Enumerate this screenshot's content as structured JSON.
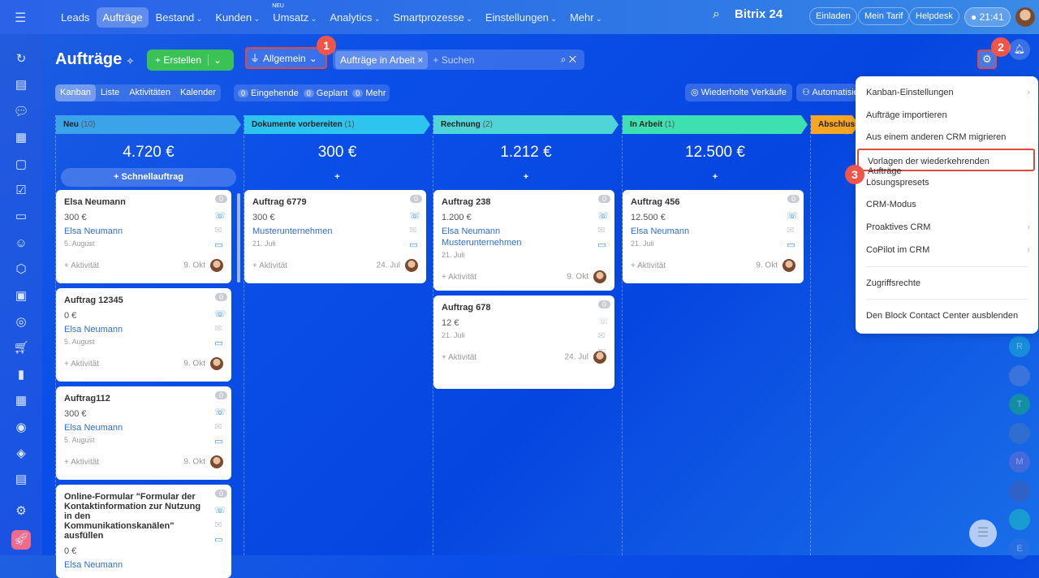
{
  "nav": {
    "items": [
      "Leads",
      "Aufträge",
      "Bestand",
      "Kunden",
      "Umsatz",
      "Analytics",
      "Smartprozesse",
      "Einstellungen",
      "Mehr"
    ],
    "active": 1,
    "new_badge": "NEU",
    "logo": "Bitrix 24",
    "invite": "Einladen",
    "tariff": "Mein Tarif",
    "helpdesk": "Helpdesk",
    "time": "21:41"
  },
  "page": {
    "title": "Aufträge",
    "create": "Erstellen",
    "filter": "Allgemein",
    "chip": "Aufträge in Arbeit",
    "search_placeholder": "+ Suchen"
  },
  "views": [
    "Kanban",
    "Liste",
    "Aktivitäten",
    "Kalender"
  ],
  "counters": [
    {
      "n": "0",
      "label": "Eingehende"
    },
    {
      "n": "0",
      "label": "Geplant"
    },
    {
      "n": "0",
      "label": "Mehr"
    }
  ],
  "toolbar": {
    "repeat": "Wiederholte Verkäufe",
    "auto": "Automatisierung"
  },
  "badges": [
    "1",
    "2",
    "3"
  ],
  "colors": {
    "accent": "#3bc257",
    "highlight": "#e04a3f"
  },
  "columns": [
    {
      "name": "Neu",
      "count": "(10)",
      "sum": "4.720 €",
      "color": "#3aa3ea",
      "quick": "Schnellauftrag",
      "cards": [
        {
          "title": "Elsa Neumann",
          "amount": "300 €",
          "links": [
            "Elsa Neumann"
          ],
          "date": "5. August",
          "activity": "+ Aktivität",
          "due": "9. Okt",
          "counter": "0"
        },
        {
          "title": "Auftrag 12345",
          "amount": "0 €",
          "links": [
            "Elsa Neumann"
          ],
          "date": "5. August",
          "activity": "+ Aktivität",
          "due": "9. Okt",
          "counter": "0"
        },
        {
          "title": "Auftrag112",
          "amount": "300 €",
          "links": [
            "Elsa Neumann"
          ],
          "date": "5. August",
          "activity": "+ Aktivität",
          "due": "9. Okt",
          "counter": "0"
        },
        {
          "title": "Online-Formular \"Formular der Kontaktinformation zur Nutzung in den Kommunikationskanälen\" ausfüllen",
          "amount": "0 €",
          "links": [
            "Elsa Neumann"
          ],
          "date": "",
          "activity": "",
          "due": "",
          "counter": "0"
        }
      ]
    },
    {
      "name": "Dokumente vorbereiten",
      "count": "(1)",
      "sum": "300 €",
      "color": "#2ec4f0",
      "quick": "+",
      "cards": [
        {
          "title": "Auftrag 6779",
          "amount": "300 €",
          "links": [
            "Musterunternehmen"
          ],
          "date": "21. Juli",
          "activity": "+ Aktivität",
          "due": "24. Jul",
          "counter": "0"
        }
      ]
    },
    {
      "name": "Rechnung",
      "count": "(2)",
      "sum": "1.212 €",
      "color": "#4fd4d8",
      "quick": "+",
      "cards": [
        {
          "title": "Auftrag 238",
          "amount": "1.200 €",
          "links": [
            "Elsa Neumann",
            "Musterunternehmen"
          ],
          "date": "21. Juli",
          "activity": "+ Aktivität",
          "due": "9. Okt",
          "counter": "0"
        },
        {
          "title": "Auftrag 678",
          "amount": "12 €",
          "links": [],
          "date": "21. Juli",
          "activity": "+ Aktivität",
          "due": "24. Jul",
          "counter": "0"
        }
      ]
    },
    {
      "name": "In Arbeit",
      "count": "(1)",
      "sum": "12.500 €",
      "color": "#3de0b0",
      "quick": "+",
      "cards": [
        {
          "title": "Auftrag 456",
          "amount": "12.500 €",
          "links": [
            "Elsa Neumann"
          ],
          "date": "21. Juli",
          "activity": "+ Aktivität",
          "due": "9. Okt",
          "counter": "0"
        }
      ]
    },
    {
      "name": "Abschluss",
      "count": "",
      "sum": "",
      "color": "#f5a623",
      "quick": "",
      "cards": []
    }
  ],
  "menu": [
    {
      "label": "Kanban-Einstellungen",
      "arrow": true
    },
    {
      "label": "Aufträge importieren"
    },
    {
      "label": "Aus einem anderen CRM migrieren"
    },
    {
      "label": "Vorlagen der wiederkehrenden Aufträge",
      "highlight": true
    },
    {
      "label": "Lösungspresets"
    },
    {
      "label": "CRM-Modus"
    },
    {
      "label": "Proaktives CRM",
      "arrow": true
    },
    {
      "label": "CoPilot im CRM",
      "arrow": true
    },
    {
      "divider": true
    },
    {
      "label": "Zugriffsrechte"
    },
    {
      "divider": true
    },
    {
      "label": "Den Block Contact Center ausblenden"
    }
  ],
  "right_avatars": [
    "R",
    "",
    "T",
    "",
    "M",
    "",
    "",
    "E"
  ]
}
